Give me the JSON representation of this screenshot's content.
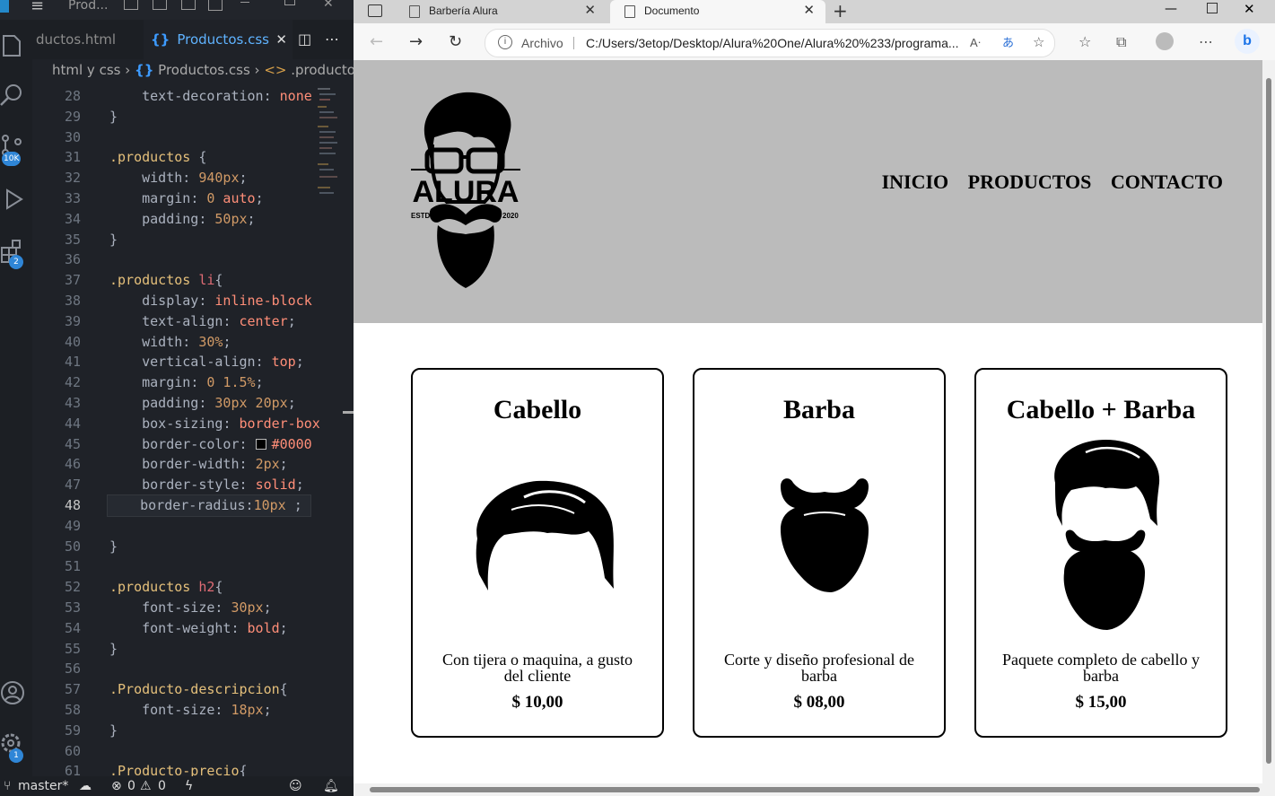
{
  "vscode": {
    "title": "Prod...",
    "tabs": [
      {
        "label": "ductos.html"
      },
      {
        "label": "Productos.css",
        "icon": "css-icon"
      }
    ],
    "breadcrumb": {
      "folder": "html y css",
      "file": "Productos.css",
      "symbol": ".productos li"
    },
    "badges": {
      "source_control": "10K",
      "extensions": "2",
      "settings": "1"
    },
    "status": {
      "branch": "master*",
      "errors": "0",
      "warnings": "0"
    }
  },
  "code_lines": [
    {
      "n": "28",
      "html": "<span class=\"prop\">    text-decoration</span><span class=\"punc\">: </span><span class=\"kw\">none</span>"
    },
    {
      "n": "29",
      "html": "<span class=\"punc\">}</span>"
    },
    {
      "n": "30",
      "html": ""
    },
    {
      "n": "31",
      "html": "<span class=\"sel-cls\">.productos</span><span class=\"punc\"> {</span>"
    },
    {
      "n": "32",
      "html": "<span class=\"prop\">    width</span><span class=\"punc\">: </span><span class=\"num\">940px</span><span class=\"punc\">;</span>"
    },
    {
      "n": "33",
      "html": "<span class=\"prop\">    margin</span><span class=\"punc\">: </span><span class=\"num\">0</span><span class=\"kw\"> auto</span><span class=\"punc\">;</span>"
    },
    {
      "n": "34",
      "html": "<span class=\"prop\">    padding</span><span class=\"punc\">: </span><span class=\"num\">50px</span><span class=\"punc\">;</span>"
    },
    {
      "n": "35",
      "html": "<span class=\"punc\">}</span>"
    },
    {
      "n": "36",
      "html": ""
    },
    {
      "n": "37",
      "html": "<span class=\"sel-cls\">.productos</span><span class=\"sel-tag\"> li</span><span class=\"punc\">{</span>"
    },
    {
      "n": "38",
      "html": "<span class=\"prop\">    display</span><span class=\"punc\">: </span><span class=\"kw\">inline-block</span>"
    },
    {
      "n": "39",
      "html": "<span class=\"prop\">    text-align</span><span class=\"punc\">: </span><span class=\"kw\">center</span><span class=\"punc\">;</span>"
    },
    {
      "n": "40",
      "html": "<span class=\"prop\">    width</span><span class=\"punc\">: </span><span class=\"num\">30%</span><span class=\"punc\">;</span>"
    },
    {
      "n": "41",
      "html": "<span class=\"prop\">    vertical-align</span><span class=\"punc\">: </span><span class=\"kw\">top</span><span class=\"punc\">;</span>"
    },
    {
      "n": "42",
      "html": "<span class=\"prop\">    margin</span><span class=\"punc\">: </span><span class=\"num\">0 1.5%</span><span class=\"punc\">;</span>"
    },
    {
      "n": "43",
      "html": "<span class=\"prop\">    padding</span><span class=\"punc\">: </span><span class=\"num\">30px 20px</span><span class=\"punc\">;</span>"
    },
    {
      "n": "44",
      "html": "<span class=\"prop\">    box-sizing</span><span class=\"punc\">: </span><span class=\"kw\">border-box</span>"
    },
    {
      "n": "45",
      "html": "<span class=\"prop\">    border-color</span><span class=\"punc\">: </span><span class=\"swatch\"></span><span class=\"kw\">#0000</span>"
    },
    {
      "n": "46",
      "html": "<span class=\"prop\">    border-width</span><span class=\"punc\">: </span><span class=\"num\">2px</span><span class=\"punc\">;</span>"
    },
    {
      "n": "47",
      "html": "<span class=\"prop\">    border-style</span><span class=\"punc\">: </span><span class=\"kw\">solid</span><span class=\"punc\">;</span>"
    },
    {
      "n": "48",
      "html": "<span class=\"prop\">    border-radius</span><span class=\"punc\">:</span><span class=\"num\">10px</span><span class=\"punc\"> ;</span>",
      "current": true
    },
    {
      "n": "49",
      "html": ""
    },
    {
      "n": "50",
      "html": "<span class=\"punc\">}</span>"
    },
    {
      "n": "51",
      "html": ""
    },
    {
      "n": "52",
      "html": "<span class=\"sel-cls\">.productos</span><span class=\"sel-tag\"> h2</span><span class=\"punc\">{</span>"
    },
    {
      "n": "53",
      "html": "<span class=\"prop\">    font-size</span><span class=\"punc\">: </span><span class=\"num\">30px</span><span class=\"punc\">;</span>"
    },
    {
      "n": "54",
      "html": "<span class=\"prop\">    font-weight</span><span class=\"punc\">: </span><span class=\"kw\">bold</span><span class=\"punc\">;</span>"
    },
    {
      "n": "55",
      "html": "<span class=\"punc\">}</span>"
    },
    {
      "n": "56",
      "html": ""
    },
    {
      "n": "57",
      "html": "<span class=\"sel-cls\">.Producto-descripcion</span><span class=\"punc\">{</span>"
    },
    {
      "n": "58",
      "html": "<span class=\"prop\">    font-size</span><span class=\"punc\">: </span><span class=\"num\">18px</span><span class=\"punc\">;</span>"
    },
    {
      "n": "59",
      "html": "<span class=\"punc\">}</span>"
    },
    {
      "n": "60",
      "html": ""
    },
    {
      "n": "61",
      "html": "<span class=\"sel-cls\">.Producto-precio</span><span class=\"punc\">{</span>"
    }
  ],
  "browser": {
    "tabs": [
      {
        "label": "Barbería Alura"
      },
      {
        "label": "Documento"
      }
    ],
    "address": {
      "scheme_label": "Archivo",
      "url": "C:/Users/3etop/Desktop/Alura%20One/Alura%20%233/programa..."
    },
    "bing_label": "b"
  },
  "site": {
    "logo": {
      "name": "ALURA",
      "estd": "ESTD",
      "year": "2020"
    },
    "nav": [
      "INICIO",
      "PRODUCTOS",
      "CONTACTO"
    ],
    "products": [
      {
        "title": "Cabello",
        "description": "Con tijera o maquina, a gusto del cliente",
        "price": "$ 10,00",
        "icon": "hair-icon"
      },
      {
        "title": "Barba",
        "description": "Corte y diseño profesional de barba",
        "price": "$ 08,00",
        "icon": "beard-icon"
      },
      {
        "title": "Cabello + Barba",
        "description": "Paquete completo de cabello y barba",
        "price": "$ 15,00",
        "icon": "hair-and-beard-icon"
      }
    ]
  },
  "colors": {
    "header_bg": "#bbbbbb",
    "vscode_bg": "#1f2228",
    "accent": "#2f86d7"
  }
}
